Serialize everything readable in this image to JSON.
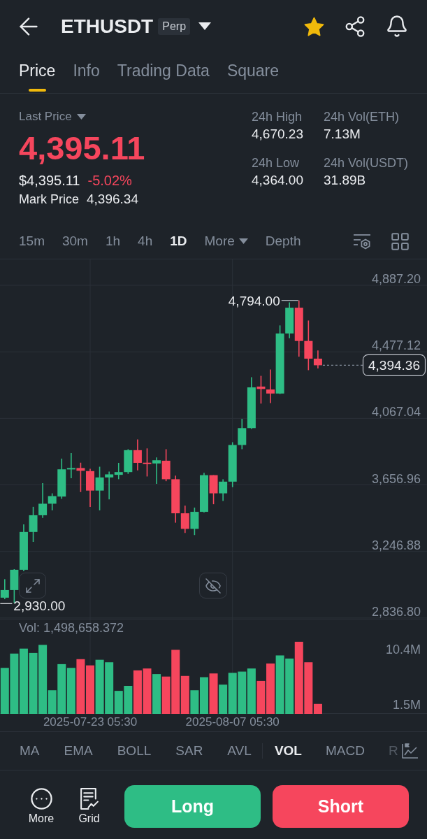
{
  "header": {
    "symbol": "ETHUSDT",
    "contract_type": "Perp",
    "favorite": true
  },
  "tabs": [
    {
      "label": "Price",
      "selected": true
    },
    {
      "label": "Info",
      "selected": false
    },
    {
      "label": "Trading Data",
      "selected": false
    },
    {
      "label": "Square",
      "selected": false
    }
  ],
  "ticker": {
    "price_type": "Last Price",
    "last_price": "4,395.11",
    "usd_price": "$4,395.11",
    "change": "-5.02%",
    "mark_price_label": "Mark Price",
    "mark_price": "4,396.34"
  },
  "stats": [
    {
      "label": "24h High",
      "value": "4,670.23"
    },
    {
      "label": "24h Vol(ETH)",
      "value": "7.13M"
    },
    {
      "label": "24h Low",
      "value": "4,364.00"
    },
    {
      "label": "24h Vol(USDT)",
      "value": "31.89B"
    }
  ],
  "intervals": [
    {
      "label": "15m",
      "kind": "interval",
      "selected": false
    },
    {
      "label": "30m",
      "kind": "interval",
      "selected": false
    },
    {
      "label": "1h",
      "kind": "interval",
      "selected": false
    },
    {
      "label": "4h",
      "kind": "interval",
      "selected": false
    },
    {
      "label": "1D",
      "kind": "interval",
      "selected": true
    },
    {
      "label": "More",
      "kind": "menu",
      "selected": false
    },
    {
      "label": "Depth",
      "kind": "view",
      "selected": false
    }
  ],
  "price_chart": {
    "chart_data": {
      "type": "candlestick",
      "grid": true,
      "ohlc": [
        [
          2962,
          3076,
          2953,
          3009
        ],
        [
          3009,
          3138,
          2930,
          3134
        ],
        [
          3134,
          3414,
          3125,
          3367
        ],
        [
          3367,
          3522,
          3306,
          3470
        ],
        [
          3470,
          3668,
          3453,
          3541
        ],
        [
          3541,
          3605,
          3500,
          3588
        ],
        [
          3585,
          3819,
          3571,
          3753
        ],
        [
          3753,
          3853,
          3698,
          3761
        ],
        [
          3761,
          3794,
          3613,
          3744
        ],
        [
          3742,
          3756,
          3521,
          3622
        ],
        [
          3622,
          3769,
          3500,
          3703
        ],
        [
          3703,
          3739,
          3568,
          3722
        ],
        [
          3719,
          3793,
          3692,
          3736
        ],
        [
          3736,
          3877,
          3725,
          3871
        ],
        [
          3871,
          3937,
          3747,
          3793
        ],
        [
          3794,
          3882,
          3709,
          3786
        ],
        [
          3789,
          3826,
          3664,
          3809
        ],
        [
          3806,
          3877,
          3680,
          3692
        ],
        [
          3692,
          3714,
          3424,
          3482
        ],
        [
          3482,
          3529,
          3361,
          3386
        ],
        [
          3386,
          3517,
          3348,
          3491
        ],
        [
          3491,
          3731,
          3487,
          3717
        ],
        [
          3717,
          3717,
          3538,
          3605
        ],
        [
          3605,
          3692,
          3558,
          3677
        ],
        [
          3677,
          3920,
          3643,
          3903
        ],
        [
          3903,
          4064,
          3877,
          4007
        ],
        [
          4007,
          4321,
          4002,
          4258
        ],
        [
          4263,
          4329,
          4158,
          4248
        ],
        [
          4245,
          4368,
          4161,
          4220
        ],
        [
          4220,
          4640,
          4217,
          4590
        ],
        [
          4590,
          4782,
          4561,
          4749
        ],
        [
          4749,
          4794,
          4447,
          4544
        ],
        [
          4544,
          4670,
          4364,
          4435
        ],
        [
          4435,
          4485,
          4375,
          4394.36
        ]
      ],
      "ylim": [
        2832,
        5051
      ],
      "yticks": [
        {
          "value": 4887.2,
          "label": "4,887.20"
        },
        {
          "value": 4477.12,
          "label": "4,477.12"
        },
        {
          "value": 4067.04,
          "label": "4,067.04"
        },
        {
          "value": 3656.96,
          "label": "3,656.96"
        },
        {
          "value": 3246.88,
          "label": "3,246.88"
        },
        {
          "value": 2836.8,
          "label": "2,836.80"
        }
      ]
    },
    "high_label": "4,794.00",
    "low_label": "2,930.00",
    "current_price_tag": "4,394.36"
  },
  "volume": {
    "legend": "Vol: 1,498,658.372",
    "chart_data": {
      "type": "bar",
      "stacked": true,
      "grid": true,
      "categories": [
        null,
        null,
        null,
        null,
        null,
        null,
        null,
        null,
        null,
        "2025-07-23 05:30",
        null,
        null,
        null,
        null,
        null,
        null,
        null,
        null,
        null,
        null,
        null,
        null,
        null,
        null,
        "2025-08-07 05:30",
        null,
        null,
        null,
        null,
        null,
        null,
        null,
        null,
        null
      ],
      "ylim": [
        0,
        15.3
      ],
      "yticks": [
        {
          "value": 10.4,
          "label": "10.4M"
        },
        {
          "value": 1.5,
          "label": "1.5M"
        }
      ],
      "series": [
        {
          "color": "#2ebd85",
          "values": [
            7.4,
            9.7,
            10.5,
            9.8,
            11.1,
            3.8,
            8.0,
            7.4,
            null,
            null,
            8.7,
            8.3,
            3.7,
            4.5,
            null,
            null,
            6.4,
            null,
            null,
            null,
            3.8,
            5.9,
            null,
            4.7,
            6.6,
            6.8,
            7.3,
            null,
            null,
            9.4,
            8.9,
            null,
            null,
            null
          ]
        },
        {
          "color": "#f6465d",
          "values": [
            null,
            null,
            null,
            null,
            null,
            null,
            null,
            null,
            8.8,
            7.8,
            null,
            null,
            null,
            null,
            7.0,
            7.3,
            null,
            6.0,
            10.3,
            6.1,
            null,
            null,
            6.5,
            null,
            null,
            null,
            null,
            5.3,
            8.1,
            null,
            null,
            11.6,
            8.3,
            1.6
          ]
        }
      ]
    }
  },
  "indicators": {
    "main": [
      {
        "label": "MA",
        "selected": false
      },
      {
        "label": "EMA",
        "selected": false
      },
      {
        "label": "BOLL",
        "selected": false
      },
      {
        "label": "SAR",
        "selected": false
      },
      {
        "label": "AVL",
        "selected": false
      }
    ],
    "sub": [
      {
        "label": "VOL",
        "selected": true
      },
      {
        "label": "MACD",
        "selected": false
      },
      {
        "label": "R",
        "selected": false
      }
    ]
  },
  "bottom_bar": {
    "actions": [
      {
        "label": "More",
        "kind": "more"
      },
      {
        "label": "Grid",
        "kind": "grid"
      }
    ],
    "trade_buttons": [
      {
        "label": "Long",
        "kind": "long"
      },
      {
        "label": "Short",
        "kind": "short"
      }
    ]
  }
}
